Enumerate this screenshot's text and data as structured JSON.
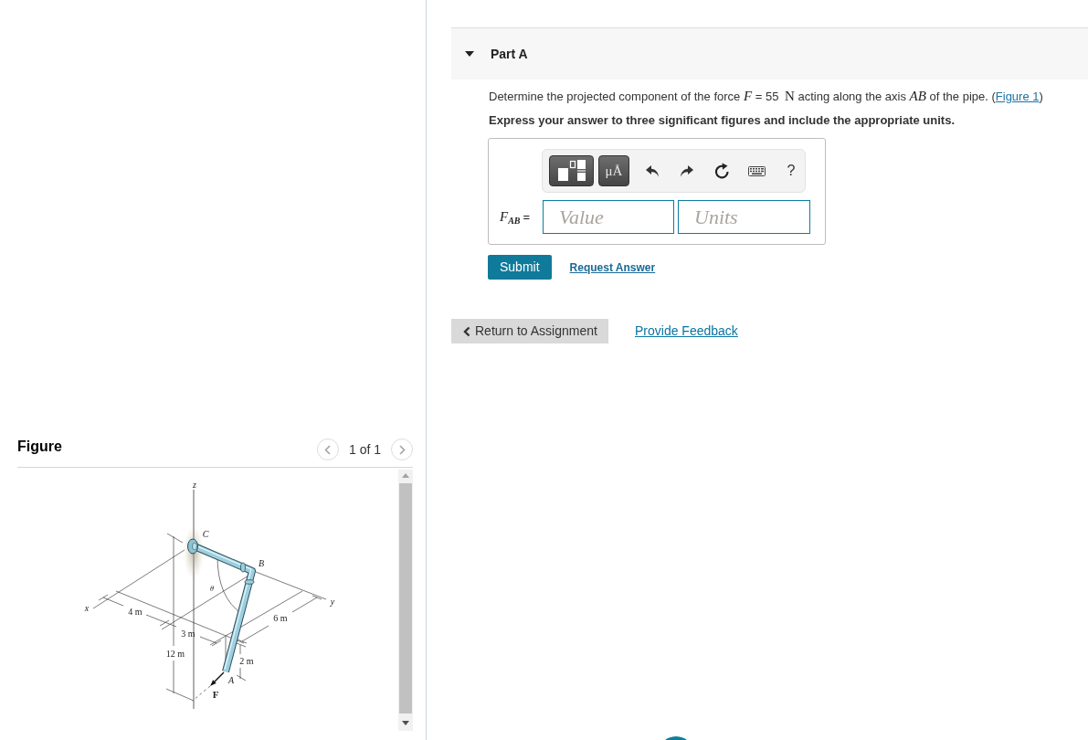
{
  "figure_panel": {
    "title": "Figure",
    "pager": "1 of 1",
    "labels": [
      {
        "kind": "axis",
        "text": "z"
      },
      {
        "kind": "point",
        "text": "C"
      },
      {
        "kind": "point",
        "text": "B"
      },
      {
        "kind": "angle",
        "text": "θ"
      },
      {
        "kind": "axis",
        "text": "x"
      },
      {
        "kind": "axis",
        "text": "y"
      },
      {
        "kind": "dimension",
        "text": "4 m"
      },
      {
        "kind": "dimension",
        "text": "6 m"
      },
      {
        "kind": "dimension",
        "text": "3 m"
      },
      {
        "kind": "dimension",
        "text": "12 m"
      },
      {
        "kind": "dimension",
        "text": "2 m"
      },
      {
        "kind": "point",
        "text": "A"
      },
      {
        "kind": "force",
        "text": "F"
      }
    ]
  },
  "part": {
    "title": "Part A",
    "expanded": true,
    "question": [
      {
        "kind": "text",
        "text": "Determine the projected component of the force "
      },
      {
        "kind": "var",
        "text": "F"
      },
      {
        "kind": "text",
        "text": " = 55 "
      },
      {
        "kind": "unit",
        "text": "N"
      },
      {
        "kind": "text",
        "text": " acting along the axis "
      },
      {
        "kind": "var",
        "text": "AB"
      },
      {
        "kind": "text",
        "text": " of the pipe. ("
      },
      {
        "kind": "link",
        "text": "Figure 1"
      },
      {
        "kind": "text",
        "text": ")"
      }
    ],
    "instruction": "Express your answer to three significant figures and include the appropriate units.",
    "answer": {
      "symbol": "F",
      "subscript": "AB",
      "sign": "=",
      "toolbar": [
        {
          "kind": "templates"
        },
        {
          "kind": "units",
          "label": "μÅ"
        },
        {
          "kind": "undo"
        },
        {
          "kind": "redo"
        },
        {
          "kind": "reset"
        },
        {
          "kind": "keyboard"
        },
        {
          "kind": "help",
          "label": "?"
        }
      ],
      "value": {
        "placeholder": "Value"
      },
      "units": {
        "placeholder": "Units"
      }
    },
    "actions": [
      {
        "kind": "primary",
        "label": "Submit"
      },
      {
        "kind": "link",
        "label": "Request Answer"
      }
    ]
  },
  "footer": [
    {
      "kind": "back",
      "label": "Return to Assignment"
    },
    {
      "kind": "link",
      "label": "Provide Feedback"
    }
  ]
}
